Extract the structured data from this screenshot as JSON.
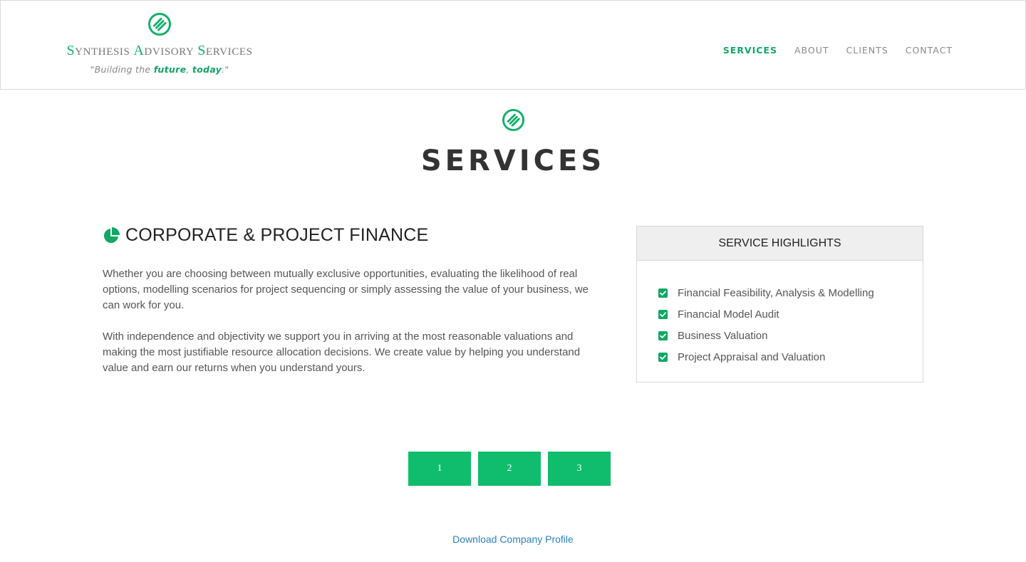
{
  "header": {
    "brand": {
      "words": [
        {
          "cap": "S",
          "rest": "ynthesis"
        },
        {
          "cap": "A",
          "rest": "dvisory"
        },
        {
          "cap": "S",
          "rest": "ervices"
        }
      ],
      "tagline": {
        "prefix": "\"Building the ",
        "word1": "future",
        "sep": ", ",
        "word2": "today",
        "suffix": ".\""
      },
      "logo_icon": "synthesis-logo-icon"
    },
    "nav": [
      {
        "label": "Services",
        "active": true
      },
      {
        "label": "About",
        "active": false
      },
      {
        "label": "Clients",
        "active": false
      },
      {
        "label": "Contact",
        "active": false
      }
    ]
  },
  "section": {
    "title": "SERVICES",
    "icon": "synthesis-logo-icon"
  },
  "service": {
    "icon": "pie-chart-icon",
    "heading": "Corporate & Project Finance",
    "paragraphs": [
      "Whether you are choosing between mutually exclusive opportunities, evaluating the likelihood of real options, modelling scenarios for project sequencing or simply assessing the value of your business, we can work for you.",
      "With independence and objectivity we support you in arriving at the most reasonable valuations and making the most justifiable resource allocation decisions. We create value by helping you understand value and earn our returns when you understand yours."
    ]
  },
  "highlights": {
    "title": "Service Highlights",
    "items": [
      "Financial Feasibility, Analysis & Modelling",
      "Financial Model Audit",
      "Business Valuation",
      "Project Appraisal and Valuation"
    ],
    "item_icon": "check-square-icon"
  },
  "pager": [
    "1",
    "2",
    "3"
  ],
  "download": {
    "label": "Download Company Profile"
  },
  "colors": {
    "accent": "#0fbd6c",
    "accent_dark": "#12a463",
    "link": "#2d7fc1"
  }
}
